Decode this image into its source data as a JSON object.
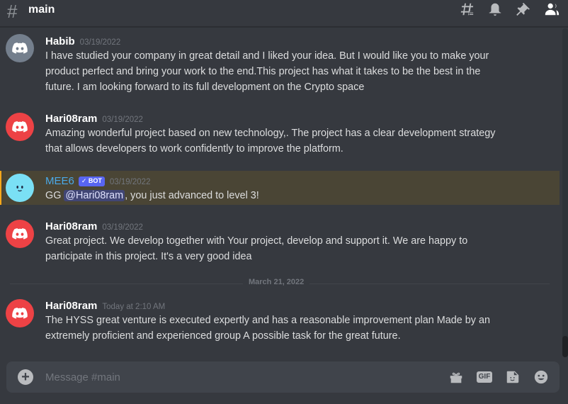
{
  "channel": {
    "hash": "#",
    "name": "main"
  },
  "colors": {
    "bg": "#36393f",
    "discord_red": "#ed4245",
    "discord_grey": "#747f8d",
    "mee6": "#7ae0f5",
    "blurple": "#5865f2"
  },
  "messages": [
    {
      "author": "Habib",
      "timestamp": "03/19/2022",
      "avatar": "discord-logo-grey",
      "lines": [
        "I have studied your company in great detail and I liked your idea. But I would like you to make your",
        "product perfect and bring your work to the end.This project has what it takes to be the best in the",
        "future. I am looking forward to its full development on the Crypto space"
      ]
    },
    {
      "author": "Hari08ram",
      "timestamp": "03/19/2022",
      "avatar": "discord-logo-red",
      "lines": [
        "Amazing wonderful project based on new technology,. The project has a clear development strategy",
        "that allows developers to work confidently to improve the platform."
      ]
    },
    {
      "author": "MEE6",
      "bot_tag": "✓ BOT",
      "timestamp": "03/19/2022",
      "avatar": "mee6-face",
      "text_before": "GG ",
      "mention": "@Hari08ram",
      "text_after": ", you just advanced to level 3!"
    },
    {
      "author": "Hari08ram",
      "timestamp": "03/19/2022",
      "avatar": "discord-logo-red",
      "lines": [
        "Great project. We develop together with Your project, develop and support it. We are happy to",
        "participate in this project. It's a very good idea"
      ]
    },
    {
      "author": "Hari08ram",
      "timestamp": "Today at 2:10 AM",
      "avatar": "discord-logo-red",
      "lines": [
        "The HYSS great venture is executed expertly and has a reasonable improvement plan Made by an",
        "extremely proficient and experienced group A possible task for the great future."
      ]
    }
  ],
  "date_divider": "March 21, 2022",
  "composer": {
    "placeholder": "Message #main",
    "gif_label": "GIF"
  }
}
